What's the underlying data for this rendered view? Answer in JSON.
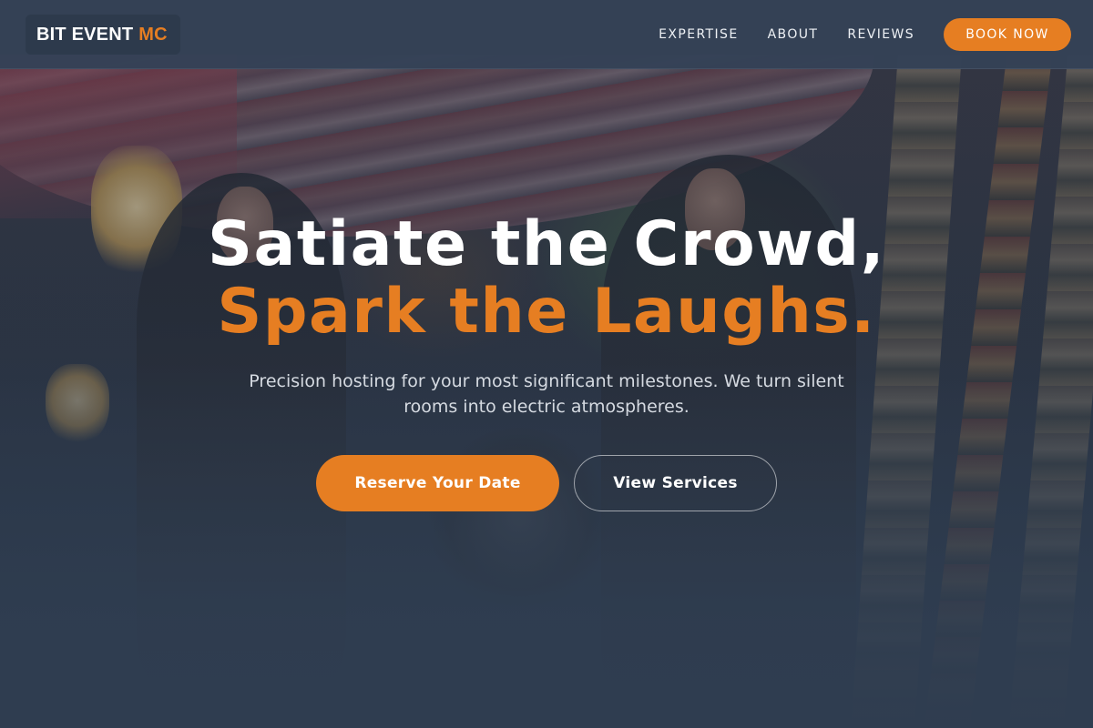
{
  "brand": {
    "name_main": "BIT EVENT",
    "name_accent": "MC"
  },
  "nav": {
    "links": [
      "EXPERTISE",
      "ABOUT",
      "REVIEWS"
    ],
    "cta_label": "BOOK NOW"
  },
  "hero": {
    "headline_line1": "Satiate the Crowd,",
    "headline_line2": "Spark the Laughs.",
    "subtext": "Precision hosting for your most significant milestones. We turn silent rooms into electric atmospheres.",
    "primary_cta": "Reserve Your Date",
    "secondary_cta": "View Services",
    "background_image": "two-women-in-leather-jackets-with-motorcycle-photo"
  },
  "colors": {
    "accent": "#e67e22",
    "header_bg": "#344256",
    "page_bg": "#2f3d50",
    "text_primary": "#ffffff",
    "text_muted": "#d5dae1"
  }
}
